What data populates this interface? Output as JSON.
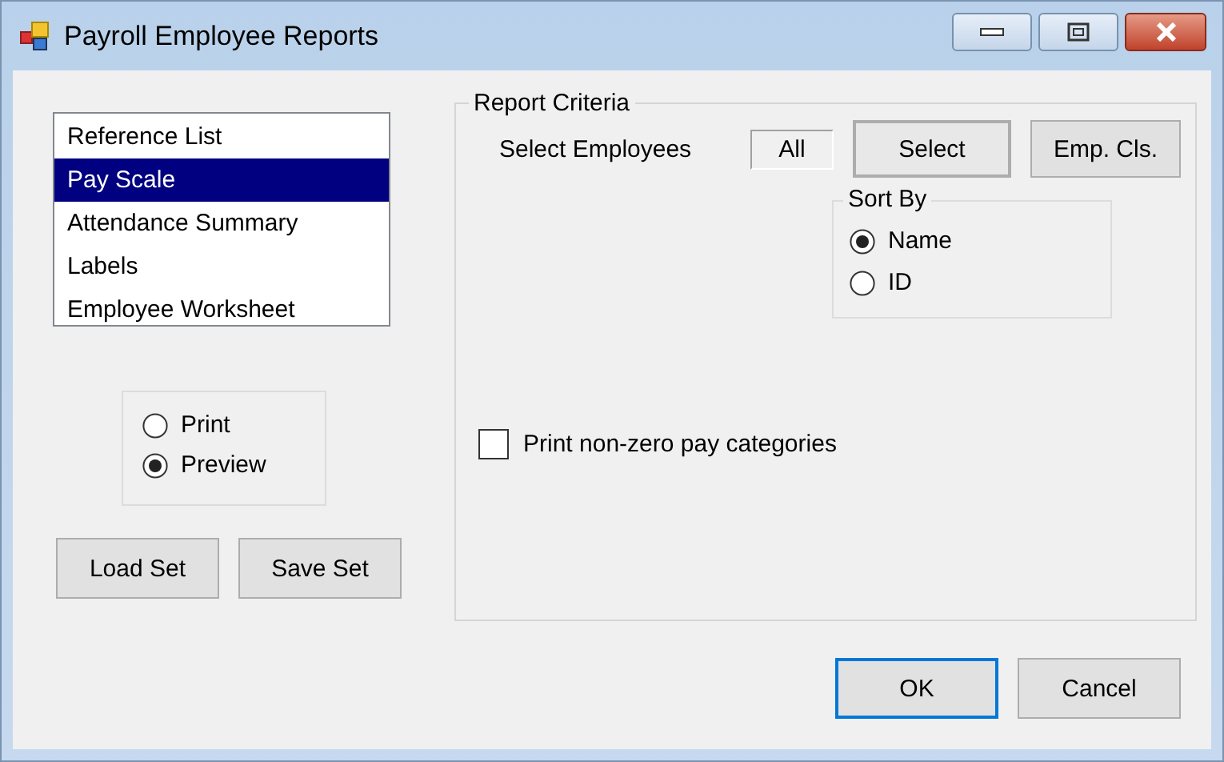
{
  "window": {
    "title": "Payroll Employee Reports"
  },
  "reports": [
    {
      "label": "Reference List",
      "selected": false
    },
    {
      "label": "Pay Scale",
      "selected": true
    },
    {
      "label": "Attendance Summary",
      "selected": false
    },
    {
      "label": "Labels",
      "selected": false
    },
    {
      "label": "Employee Worksheet",
      "selected": false
    }
  ],
  "output_options": [
    {
      "label": "Print",
      "selected": false
    },
    {
      "label": "Preview",
      "selected": true
    }
  ],
  "set_buttons": [
    "Load Set",
    "Save Set"
  ],
  "report_criteria": {
    "title": "Report Criteria",
    "select_employees_label": "Select Employees",
    "select_employees_value": "All",
    "buttons": [
      "Select",
      "Emp. Cls."
    ],
    "sort_by": {
      "title": "Sort By",
      "options": [
        {
          "label": "Name",
          "selected": true
        },
        {
          "label": "ID",
          "selected": false
        }
      ]
    },
    "non_zero": {
      "label": "Print non-zero pay categories",
      "checked": false
    }
  },
  "buttons": [
    "OK",
    "Cancel"
  ]
}
